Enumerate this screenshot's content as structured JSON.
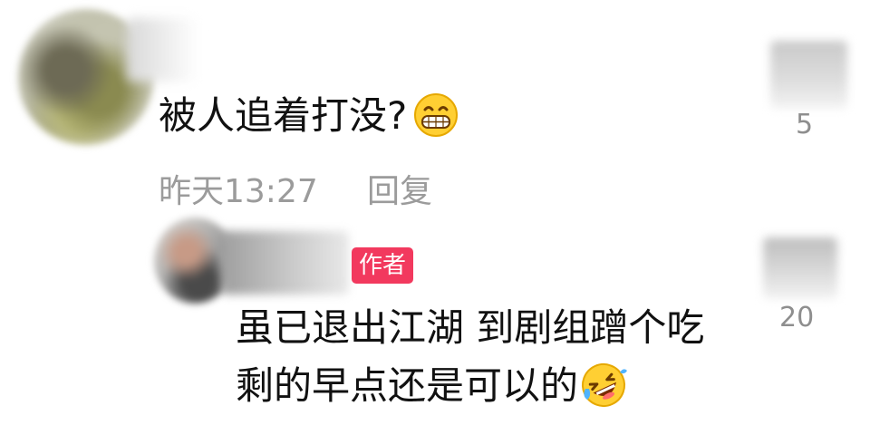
{
  "comment": {
    "text": "被人追着打没?",
    "emoji": "grin-emoji",
    "timestamp": "昨天13:27",
    "reply_label": "回复",
    "like_count": "5"
  },
  "reply": {
    "badge": "作者",
    "line1": "虽已退出江湖 到剧组蹭个吃",
    "line2": "剩的早点还是可以的",
    "emoji": "rofl-emoji",
    "like_count": "20"
  }
}
